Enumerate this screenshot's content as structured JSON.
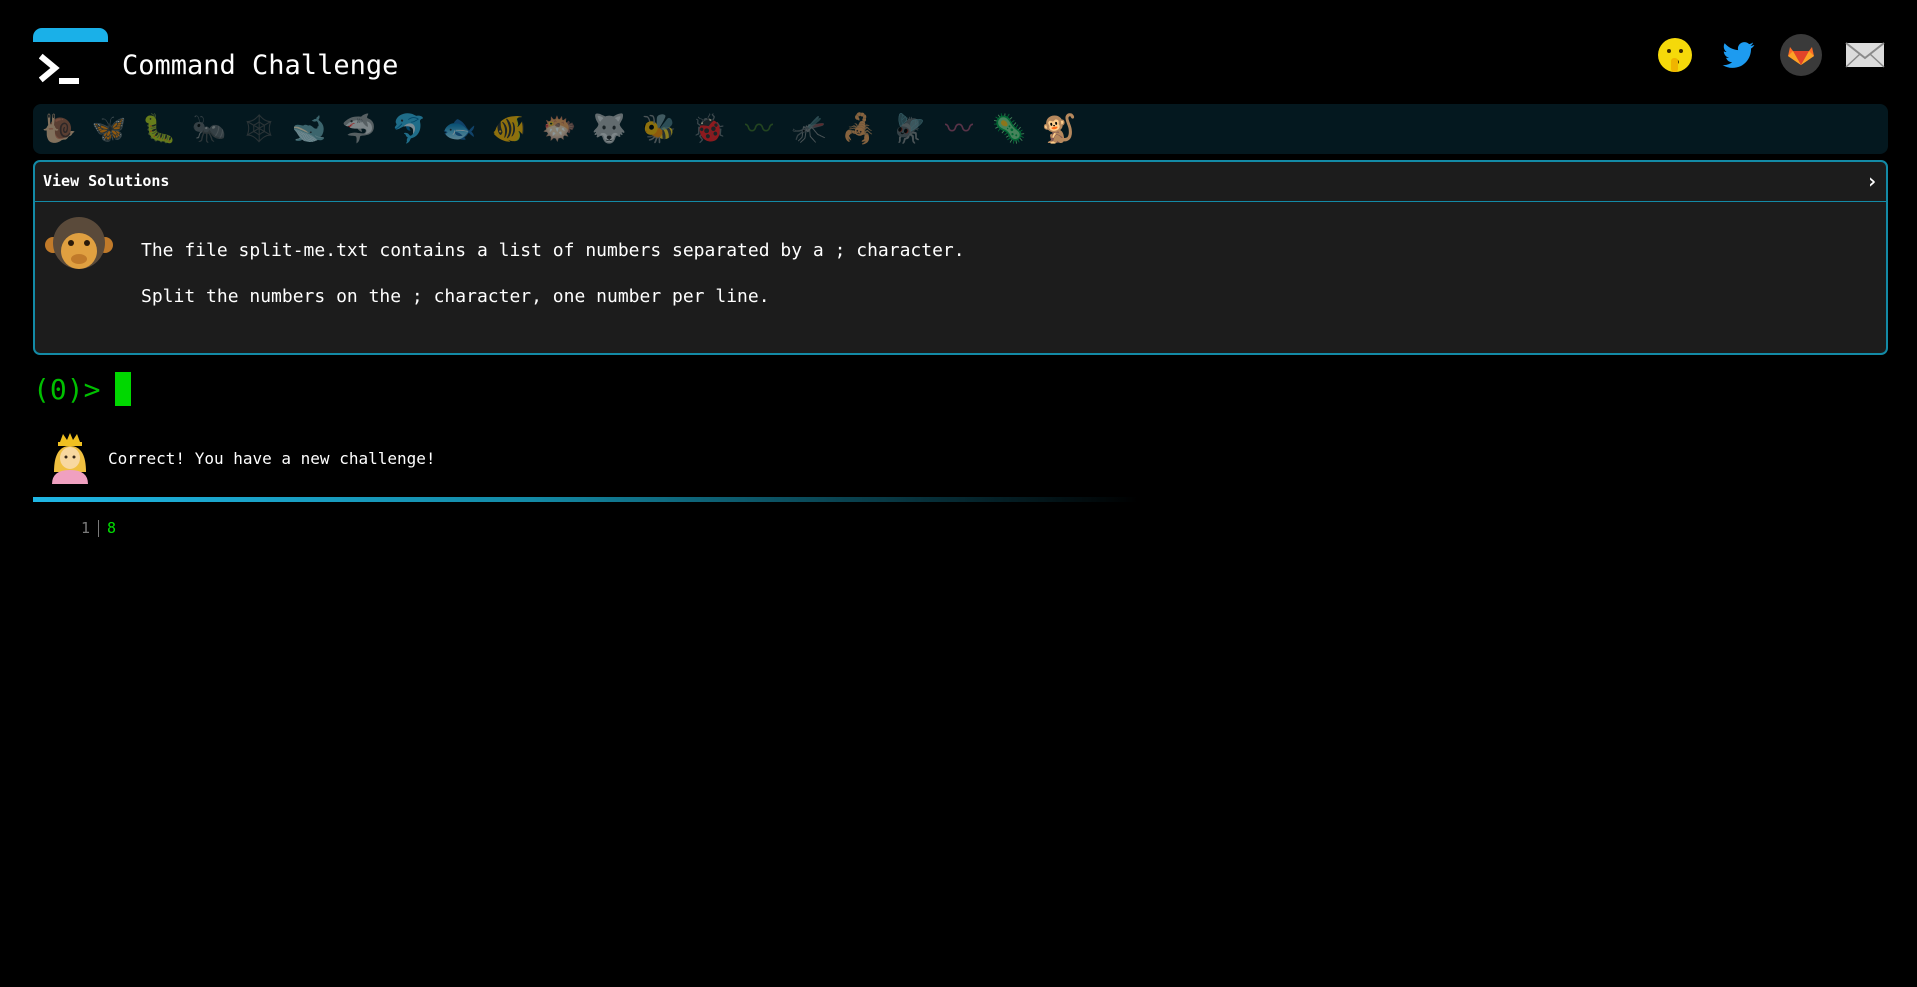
{
  "header": {
    "title": "Command Challenge",
    "social": [
      {
        "name": "shush-face-icon"
      },
      {
        "name": "twitter-icon"
      },
      {
        "name": "gitlab-icon"
      },
      {
        "name": "envelope-icon"
      }
    ]
  },
  "challenges": [
    {
      "name": "snail",
      "glyph": "🐌",
      "color": "#4a3d2a"
    },
    {
      "name": "butterfly",
      "glyph": "🦋",
      "color": "#c57a2a"
    },
    {
      "name": "caterpillar",
      "glyph": "🐛",
      "color": "#5c7a22"
    },
    {
      "name": "ant",
      "glyph": "🐜",
      "color": "#2e2e2e"
    },
    {
      "name": "spider-web",
      "glyph": "🕸",
      "color": "#4a4a4a"
    },
    {
      "name": "whale",
      "glyph": "🐋",
      "color": "#3e6e8a"
    },
    {
      "name": "shark",
      "glyph": "🦈",
      "color": "#3e6e8a"
    },
    {
      "name": "dolphin",
      "glyph": "🐬",
      "color": "#5a6e7a"
    },
    {
      "name": "fish",
      "glyph": "🐟",
      "color": "#3e7aa0"
    },
    {
      "name": "tropical-fish",
      "glyph": "🐠",
      "color": "#c0a020"
    },
    {
      "name": "blowfish",
      "glyph": "🐡",
      "color": "#6a5a3a"
    },
    {
      "name": "wolf",
      "glyph": "🐺",
      "color": "#6a6a6a"
    },
    {
      "name": "bee",
      "glyph": "🐝",
      "color": "#8a8a3a"
    },
    {
      "name": "ladybug",
      "glyph": "🐞",
      "color": "#a02a2a"
    },
    {
      "name": "worm",
      "glyph": "〰",
      "color": "#3e6a22"
    },
    {
      "name": "mosquito",
      "glyph": "🦟",
      "color": "#3a3a3a"
    },
    {
      "name": "scorpion",
      "glyph": "🦂",
      "color": "#8a2a2a"
    },
    {
      "name": "fly",
      "glyph": "🪰",
      "color": "#4a4a4a"
    },
    {
      "name": "earthworm",
      "glyph": "〰",
      "color": "#a04a6a"
    },
    {
      "name": "microbe",
      "glyph": "🦠",
      "color": "#3e6e8a"
    },
    {
      "name": "monkey",
      "glyph": "🐒",
      "color": "#8a5a2a"
    }
  ],
  "card": {
    "view_solutions": "View Solutions",
    "chevron": "›",
    "line1": "The file split-me.txt contains a list of numbers separated by a ; character.",
    "line2": "Split the numbers on the ; character, one number per line."
  },
  "prompt": {
    "label": "(0)>",
    "value": ""
  },
  "message": {
    "text": "Correct! You have a new challenge!"
  },
  "output": {
    "line_number": "1",
    "value": "8"
  },
  "colors": {
    "accent": "#1ab0e8",
    "border": "#138aa6",
    "prompt": "#00c000"
  }
}
